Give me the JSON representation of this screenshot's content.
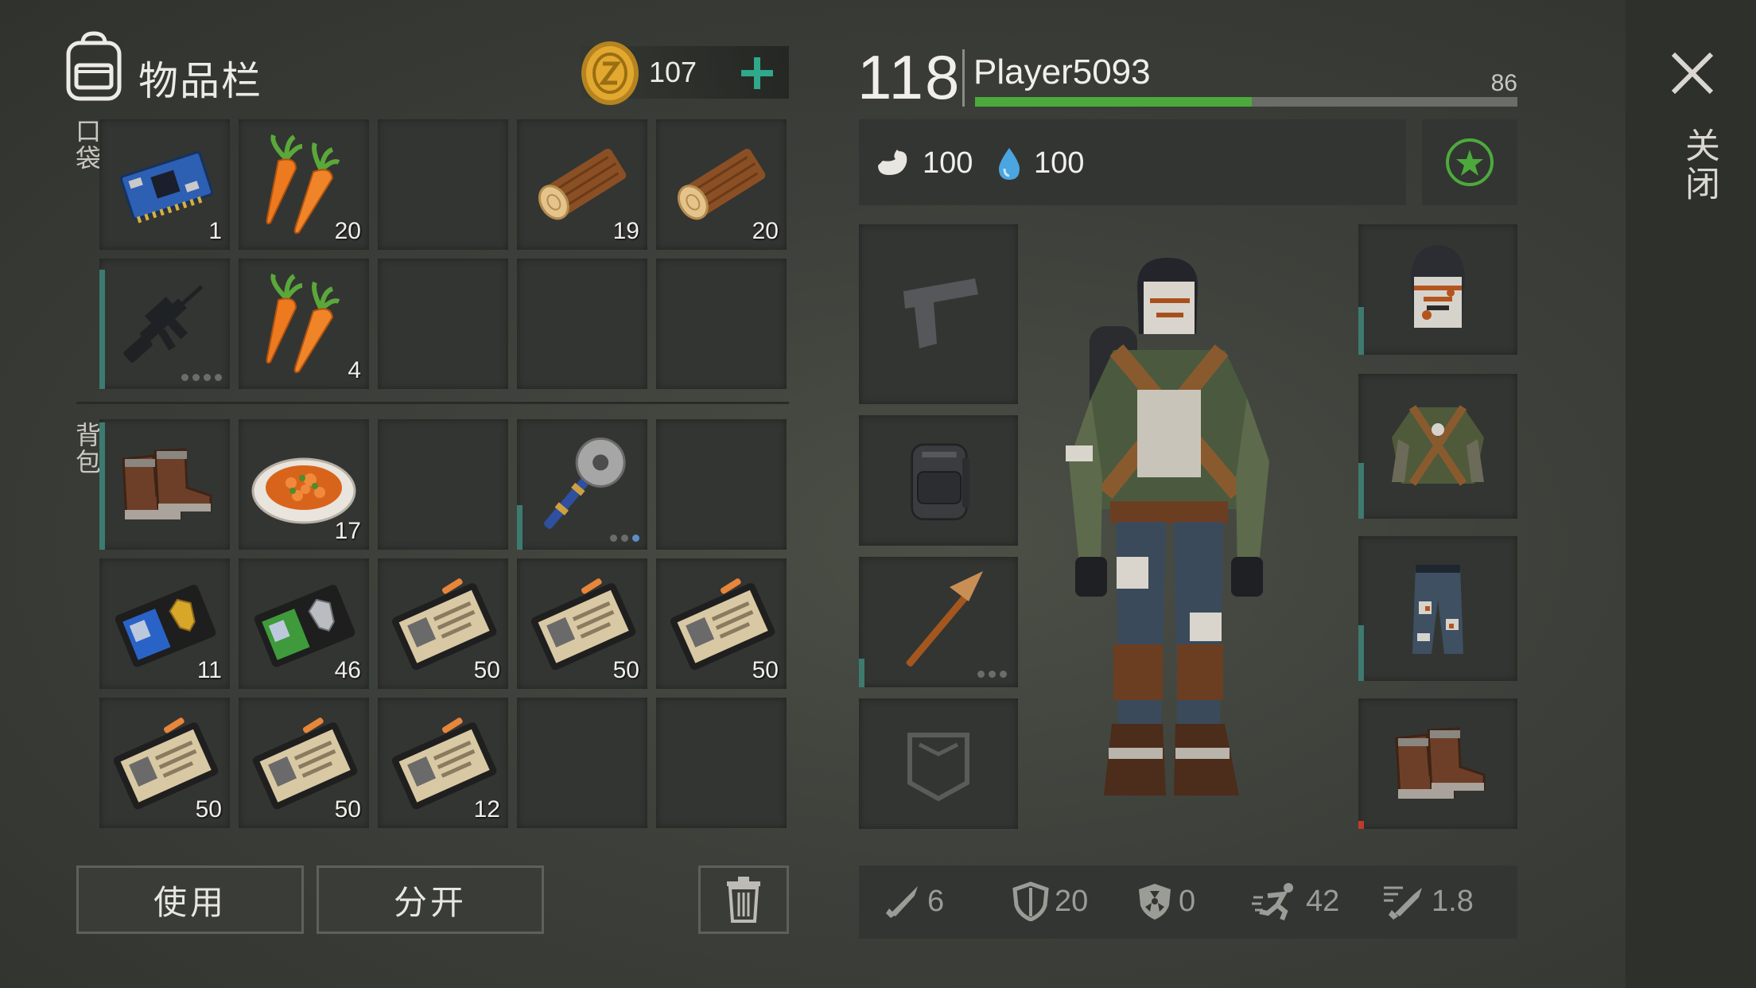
{
  "inventory": {
    "title": "物品栏",
    "coins": "107",
    "pockets_label": "口袋",
    "backpack_label": "背包",
    "pockets": [
      {
        "item": "circuit-board",
        "qty": "1"
      },
      {
        "item": "carrots",
        "qty": "20"
      },
      {
        "item": "empty",
        "qty": ""
      },
      {
        "item": "log",
        "qty": "19"
      },
      {
        "item": "log",
        "qty": "20"
      },
      {
        "item": "assault-rifle",
        "qty": ""
      },
      {
        "item": "carrots",
        "qty": "4"
      },
      {
        "item": "empty",
        "qty": ""
      },
      {
        "item": "empty",
        "qty": ""
      },
      {
        "item": "empty",
        "qty": ""
      }
    ],
    "backpack": [
      {
        "item": "boots",
        "qty": ""
      },
      {
        "item": "stew-plate",
        "qty": "17"
      },
      {
        "item": "empty",
        "qty": ""
      },
      {
        "item": "saw-mace",
        "qty": ""
      },
      {
        "item": "empty",
        "qty": ""
      },
      {
        "item": "police-badge-gold",
        "qty": "11"
      },
      {
        "item": "police-badge-silver",
        "qty": "46"
      },
      {
        "item": "patrol-officer-id",
        "qty": "50"
      },
      {
        "item": "patrol-officer-id",
        "qty": "50"
      },
      {
        "item": "patrol-officer-id",
        "qty": "50"
      },
      {
        "item": "patrol-officer-id",
        "qty": "50"
      },
      {
        "item": "patrol-officer-id",
        "qty": "50"
      },
      {
        "item": "patrol-officer-id",
        "qty": "12"
      },
      {
        "item": "empty",
        "qty": ""
      },
      {
        "item": "empty",
        "qty": ""
      }
    ],
    "use_label": "使用",
    "split_label": "分开"
  },
  "player": {
    "level": "118",
    "name": "Player5093",
    "xp": "86",
    "xp_fraction": 0.51,
    "food": "100",
    "water": "100"
  },
  "equipment": {
    "left_slots": [
      "pistol-slot",
      "backpack",
      "pickaxe",
      "pocket-slot"
    ],
    "right_slots": [
      "helmet",
      "jacket",
      "pants",
      "boots"
    ]
  },
  "stats": {
    "damage": "6",
    "armor": "20",
    "radiation_defense": "0",
    "speed": "42",
    "attack_speed": "1.8"
  },
  "close_label": "关闭",
  "colors": {
    "xp_green": "#4caa3d",
    "accent_green": "#4caa3d",
    "durability_teal": "#3d7a70",
    "background": "#3d403a"
  }
}
